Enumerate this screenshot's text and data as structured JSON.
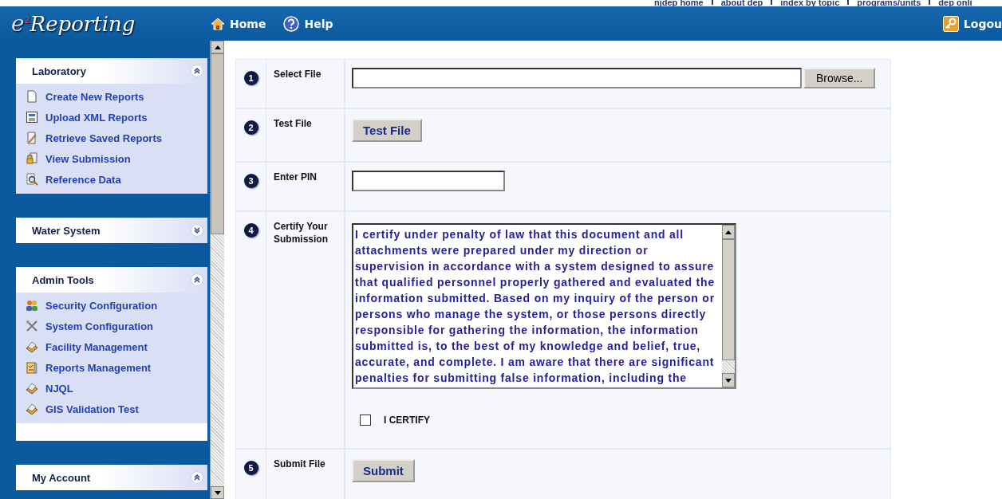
{
  "top_links": [
    "njdep home",
    "about dep",
    "index by topic",
    "programs/units",
    "dep onli"
  ],
  "header": {
    "logo": "Reporting",
    "logo_sup": "2",
    "logo_e": "e",
    "nav": [
      {
        "label": "Home",
        "kind": "home"
      },
      {
        "label": "Help",
        "kind": "help"
      }
    ],
    "logout": "Logou"
  },
  "sidebar": [
    {
      "title": "Laboratory",
      "expanded": true,
      "items": [
        {
          "label": "Create New Reports",
          "kind": "page"
        },
        {
          "label": "Upload XML Reports",
          "kind": "xml"
        },
        {
          "label": "Retrieve Saved Reports",
          "kind": "edit"
        },
        {
          "label": "View Submission",
          "kind": "lock"
        },
        {
          "label": "Reference Data",
          "kind": "search"
        }
      ]
    },
    {
      "title": "Water System",
      "expanded": false
    },
    {
      "title": "Admin Tools",
      "expanded": true,
      "items": [
        {
          "label": "Security Configuration",
          "kind": "users"
        },
        {
          "label": "System Configuration",
          "kind": "tools"
        },
        {
          "label": "Facility Management",
          "kind": "drawer"
        },
        {
          "label": "Reports Management",
          "kind": "report"
        },
        {
          "label": "NJQL",
          "kind": "drawer"
        },
        {
          "label": "GIS Validation Test",
          "kind": "drawer"
        }
      ]
    },
    {
      "title": "My Account",
      "expanded": true
    }
  ],
  "steps": [
    {
      "number": "1",
      "label": "Select File",
      "kind": "file",
      "button": "Browse..."
    },
    {
      "number": "2",
      "label": "Test File",
      "kind": "button",
      "button": "Test File"
    },
    {
      "number": "3",
      "label": "Enter PIN",
      "kind": "input"
    },
    {
      "number": "4",
      "label": "Certify Your Submission",
      "kind": "certify",
      "text": "I certify under penalty of law that this document and all attachments were prepared under my direction or supervision in accordance with a system designed to assure that qualified personnel properly gathered and evaluated the information submitted. Based on my inquiry of the person or persons who manage the system, or those persons directly responsible for gathering the information, the information submitted is, to the best of my knowledge and belief, true, accurate, and complete. I am aware that there are significant penalties for submitting false information, including the",
      "checkbox_label": "I CERTIFY",
      "checked": false
    },
    {
      "number": "5",
      "label": "Submit File",
      "kind": "button",
      "button": "Submit"
    }
  ]
}
